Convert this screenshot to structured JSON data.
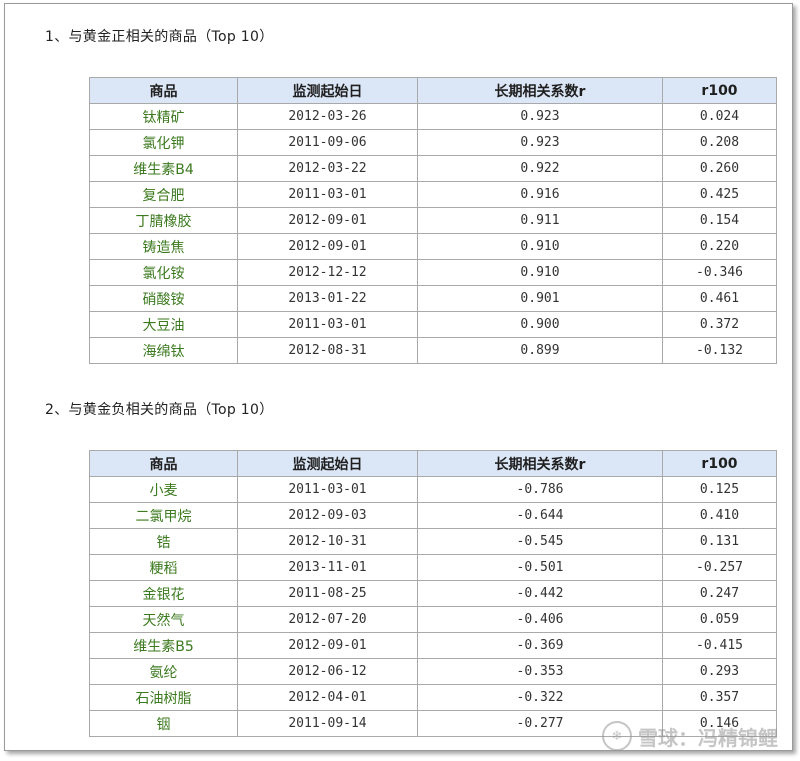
{
  "section1": {
    "title": "1、与黄金正相关的商品（Top 10）",
    "headers": [
      "商品",
      "监测起始日",
      "长期相关系数r",
      "r100"
    ],
    "rows": [
      [
        "钛精矿",
        "2012-03-26",
        "0.923",
        "0.024"
      ],
      [
        "氯化钾",
        "2011-09-06",
        "0.923",
        "0.208"
      ],
      [
        "维生素B4",
        "2012-03-22",
        "0.922",
        "0.260"
      ],
      [
        "复合肥",
        "2011-03-01",
        "0.916",
        "0.425"
      ],
      [
        "丁腈橡胶",
        "2012-09-01",
        "0.911",
        "0.154"
      ],
      [
        "铸造焦",
        "2012-09-01",
        "0.910",
        "0.220"
      ],
      [
        "氯化铵",
        "2012-12-12",
        "0.910",
        "-0.346"
      ],
      [
        "硝酸铵",
        "2013-01-22",
        "0.901",
        "0.461"
      ],
      [
        "大豆油",
        "2011-03-01",
        "0.900",
        "0.372"
      ],
      [
        "海绵钛",
        "2012-08-31",
        "0.899",
        "-0.132"
      ]
    ]
  },
  "section2": {
    "title": "2、与黄金负相关的商品（Top 10）",
    "headers": [
      "商品",
      "监测起始日",
      "长期相关系数r",
      "r100"
    ],
    "rows": [
      [
        "小麦",
        "2011-03-01",
        "-0.786",
        "0.125"
      ],
      [
        "二氯甲烷",
        "2012-09-03",
        "-0.644",
        "0.410"
      ],
      [
        "锆",
        "2012-10-31",
        "-0.545",
        "0.131"
      ],
      [
        "粳稻",
        "2013-11-01",
        "-0.501",
        "-0.257"
      ],
      [
        "金银花",
        "2011-08-25",
        "-0.442",
        "0.247"
      ],
      [
        "天然气",
        "2012-07-20",
        "-0.406",
        "0.059"
      ],
      [
        "维生素B5",
        "2012-09-01",
        "-0.369",
        "-0.415"
      ],
      [
        "氨纶",
        "2012-06-12",
        "-0.353",
        "0.293"
      ],
      [
        "石油树脂",
        "2012-04-01",
        "-0.322",
        "0.357"
      ],
      [
        "铟",
        "2011-09-14",
        "-0.277",
        "0.146"
      ]
    ]
  },
  "watermark": {
    "text": "雪球：冯精锦鲤",
    "logo_glyph": "❄"
  }
}
